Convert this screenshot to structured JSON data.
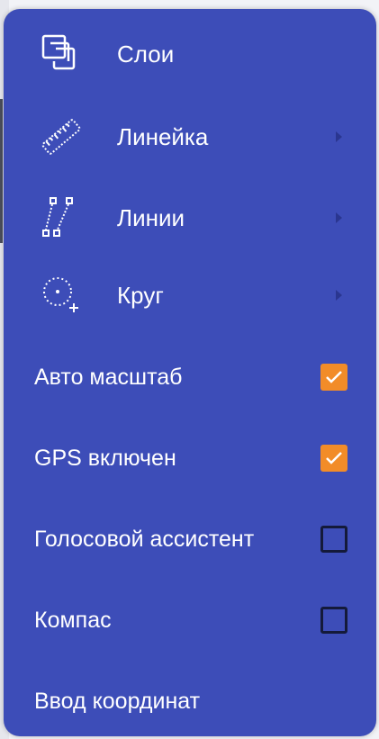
{
  "menu": {
    "items": [
      {
        "label": "Слои",
        "icon": "layers-icon",
        "has_submenu": false
      },
      {
        "label": "Линейка",
        "icon": "ruler-icon",
        "has_submenu": true
      },
      {
        "label": "Линии",
        "icon": "polyline-icon",
        "has_submenu": true
      },
      {
        "label": "Круг",
        "icon": "circle-dotted-icon",
        "has_submenu": true
      }
    ],
    "options": [
      {
        "label": "Авто масштаб",
        "checked": true
      },
      {
        "label": "GPS включен",
        "checked": true
      },
      {
        "label": "Голосовой ассистент",
        "checked": false
      },
      {
        "label": "Компас",
        "checked": false
      }
    ],
    "action": {
      "label": "Ввод координат"
    }
  },
  "colors": {
    "menu_bg": "#3d4db8",
    "text": "#ffffff",
    "checkbox_checked": "#f28c28",
    "checkbox_border": "#141a3a",
    "arrow": "#2a3690"
  }
}
